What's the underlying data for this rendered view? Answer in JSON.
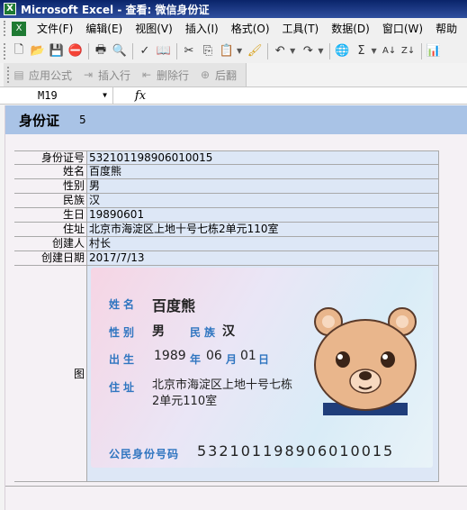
{
  "window": {
    "title": "Microsoft Excel - 查看: 微信身份证",
    "app_icon": "excel-icon"
  },
  "menu": [
    {
      "label": "文件(F)"
    },
    {
      "label": "编辑(E)"
    },
    {
      "label": "视图(V)"
    },
    {
      "label": "插入(I)"
    },
    {
      "label": "格式(O)"
    },
    {
      "label": "工具(T)"
    },
    {
      "label": "数据(D)"
    },
    {
      "label": "窗口(W)"
    },
    {
      "label": "帮助"
    }
  ],
  "toolbar2": {
    "apply_formula": "应用公式",
    "insert_row": "插入行",
    "delete_row": "删除行",
    "rollback": "后翻"
  },
  "formula_bar": {
    "cell_ref": "M19",
    "fx_label": "fx",
    "value": ""
  },
  "sheet": {
    "title": "身份证",
    "count": "5"
  },
  "record": {
    "rows": [
      {
        "label": "身份证号",
        "value": "532101198906010015"
      },
      {
        "label": "姓名",
        "value": "百度熊"
      },
      {
        "label": "性别",
        "value": "男"
      },
      {
        "label": "民族",
        "value": "汉"
      },
      {
        "label": "生日",
        "value": "19890601"
      },
      {
        "label": "住址",
        "value": "北京市海淀区上地十号七栋2单元110室"
      },
      {
        "label": "创建人",
        "value": "村长"
      },
      {
        "label": "创建日期",
        "value": "2017/7/13"
      }
    ],
    "image_label": "图"
  },
  "card": {
    "name_label": "姓名",
    "name": "百度熊",
    "gender_label": "性别",
    "gender": "男",
    "ethnic_label": "民族",
    "ethnic": "汉",
    "birth_label": "出生",
    "birth_year": "1989",
    "year_label": "年",
    "birth_month": "06",
    "month_label": "月",
    "birth_day": "01",
    "day_label": "日",
    "address_label": "住址",
    "address_line1": "北京市海淀区上地十号七栋",
    "address_line2": "2单元110室",
    "id_label": "公民身份号码",
    "id_number": "532101198906010015"
  },
  "colors": {
    "header_blue": "#a9c3e6",
    "cell_blue": "#dde7f6",
    "card_label_blue": "#2f75c0"
  }
}
